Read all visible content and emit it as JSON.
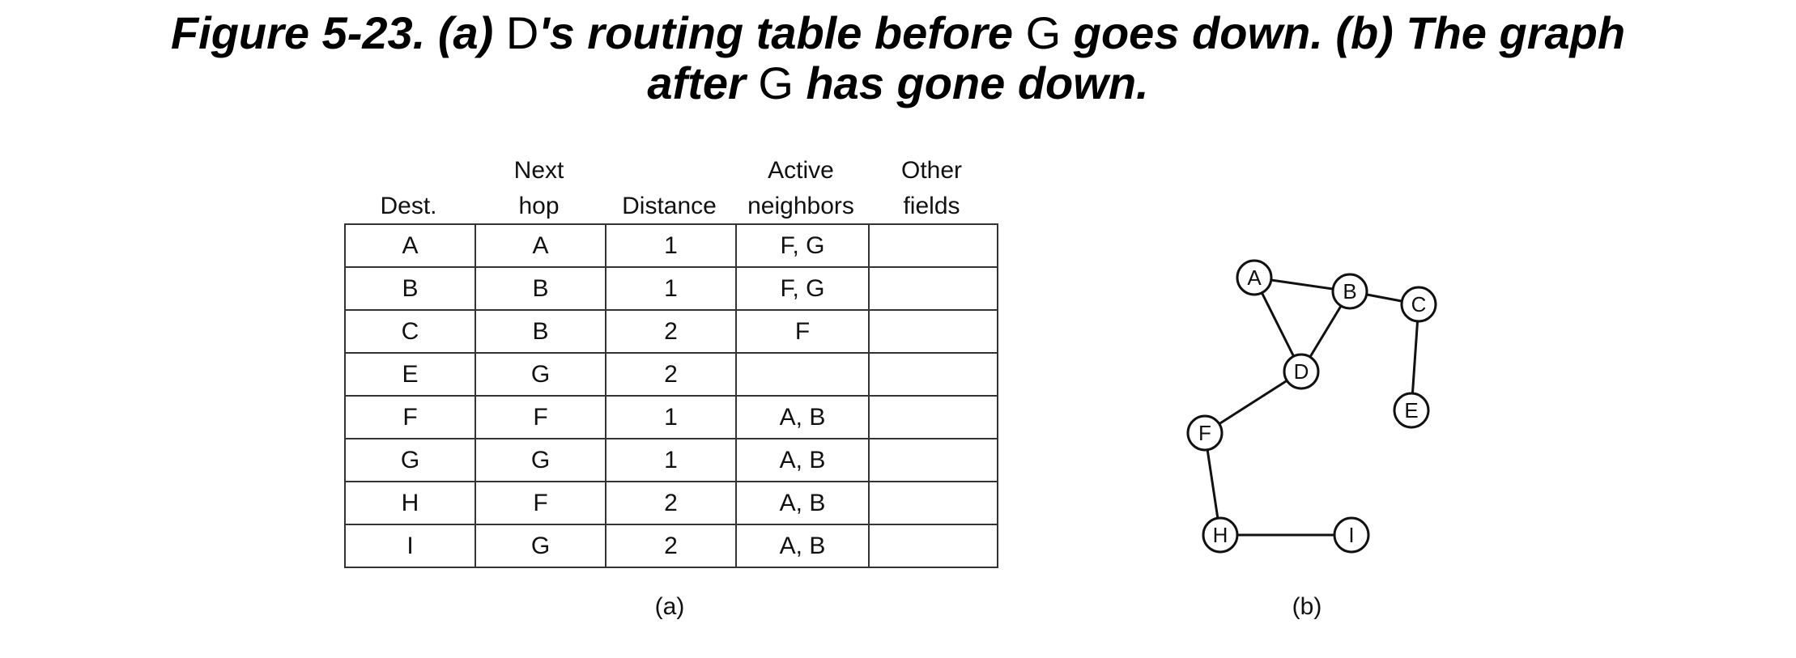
{
  "caption": {
    "line1_part1": "Figure 5-23. (a) ",
    "line1_D": "D",
    "line1_part2": "'s routing table before ",
    "line1_G": "G",
    "line1_part3": " goes down. (b) The graph",
    "line2_part1": "after ",
    "line2_G": "G",
    "line2_part2": " has gone down."
  },
  "table": {
    "headers": [
      {
        "line1": "",
        "line2": "Dest."
      },
      {
        "line1": "Next",
        "line2": "hop"
      },
      {
        "line1": "",
        "line2": "Distance"
      },
      {
        "line1": "Active",
        "line2": "neighbors"
      },
      {
        "line1": "Other",
        "line2": "fields"
      }
    ],
    "rows": [
      [
        "A",
        "A",
        "1",
        "F, G",
        ""
      ],
      [
        "B",
        "B",
        "1",
        "F, G",
        ""
      ],
      [
        "C",
        "B",
        "2",
        "F",
        ""
      ],
      [
        "E",
        "G",
        "2",
        "",
        ""
      ],
      [
        "F",
        "F",
        "1",
        "A, B",
        ""
      ],
      [
        "G",
        "G",
        "1",
        "A, B",
        ""
      ],
      [
        "H",
        "F",
        "2",
        "A, B",
        ""
      ],
      [
        "I",
        "G",
        "2",
        "A, B",
        ""
      ]
    ],
    "label": "(a)"
  },
  "graph": {
    "nodes": [
      "A",
      "B",
      "C",
      "D",
      "E",
      "F",
      "H",
      "I"
    ],
    "edges": [
      [
        "A",
        "B"
      ],
      [
        "A",
        "D"
      ],
      [
        "B",
        "D"
      ],
      [
        "B",
        "C"
      ],
      [
        "C",
        "E"
      ],
      [
        "D",
        "F"
      ],
      [
        "F",
        "H"
      ],
      [
        "H",
        "I"
      ]
    ],
    "label": "(b)"
  }
}
